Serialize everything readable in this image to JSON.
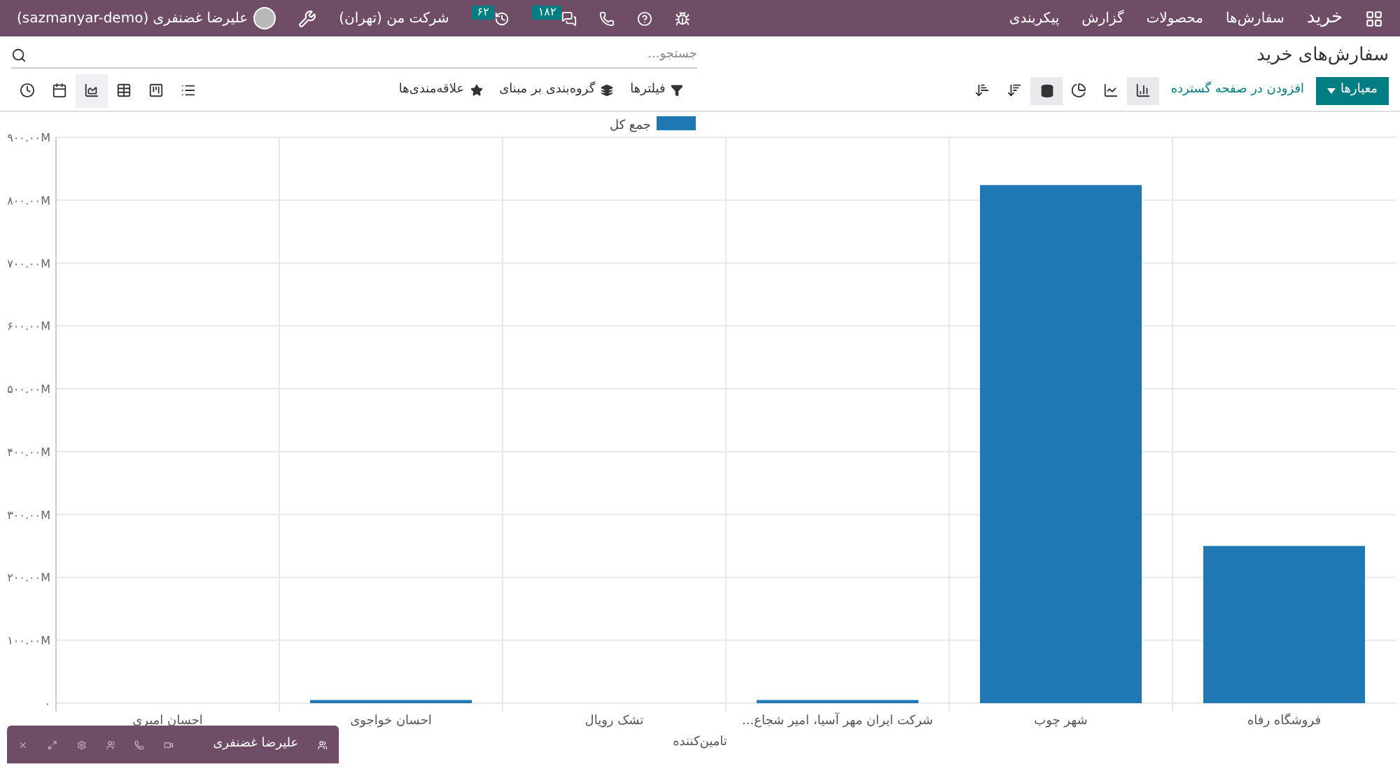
{
  "navbar": {
    "app_name": "خرید",
    "menus": [
      "سفارش‌ها",
      "محصولات",
      "گزارش",
      "پیکربندی"
    ],
    "systray": [
      {
        "kind": "bug"
      },
      {
        "kind": "help"
      },
      {
        "kind": "phone"
      },
      {
        "kind": "chat",
        "badge": "۱۸۲"
      },
      {
        "kind": "activity",
        "badge": "۶۲"
      }
    ],
    "company": "شرکت من (تهران)",
    "user": "علیرضا غضنفری (sazmanyar-demo)"
  },
  "page_title": "سفارش‌های خرید",
  "search": {
    "placeholder": "جستجو..."
  },
  "toolbar": {
    "measures_button": "معیارها",
    "insert_link": "افزودن در صفحه گسترده",
    "chart_types": [
      {
        "kind": "bar",
        "selected": true
      },
      {
        "kind": "line",
        "selected": false
      },
      {
        "kind": "pie",
        "selected": false
      }
    ],
    "stacked": {
      "on": true
    },
    "sorts": [
      {
        "kind": "descending"
      },
      {
        "kind": "ascending"
      }
    ],
    "filters": [
      {
        "kind": "filter",
        "label": "فیلترها"
      },
      {
        "kind": "group",
        "label": "گروه‌بندی بر مبنای"
      },
      {
        "kind": "favorite",
        "label": "علاقه‌مندی‌ها"
      }
    ],
    "views": [
      {
        "kind": "list",
        "selected": false
      },
      {
        "kind": "kanban",
        "selected": false
      },
      {
        "kind": "pivot",
        "selected": false
      },
      {
        "kind": "graph",
        "selected": true
      },
      {
        "kind": "calendar",
        "selected": false
      },
      {
        "kind": "activity",
        "selected": false
      }
    ]
  },
  "chart_data": {
    "type": "bar",
    "grid": true,
    "xlabel": "تامین‌کننده",
    "categories": [
      "احسان امیری",
      "احسان خواجوی",
      "تشک رویال",
      "شرکت ایران مهر آسیا، امیر شجاع...",
      "شهر چوب",
      "فروشگاه رفاه"
    ],
    "series": [
      {
        "name": "جمع کل",
        "color": "#1f77b4",
        "values": [
          0,
          5000000,
          0,
          5000000,
          824000000,
          250000000
        ]
      }
    ],
    "ylim": [
      0,
      900000000
    ],
    "yticks": [
      {
        "value": 0,
        "label": "۰"
      },
      {
        "value": 100000000,
        "label": "۱۰۰.۰۰M"
      },
      {
        "value": 200000000,
        "label": "۲۰۰.۰۰M"
      },
      {
        "value": 300000000,
        "label": "۳۰۰.۰۰M"
      },
      {
        "value": 400000000,
        "label": "۴۰۰.۰۰M"
      },
      {
        "value": 500000000,
        "label": "۵۰۰.۰۰M"
      },
      {
        "value": 600000000,
        "label": "۶۰۰.۰۰M"
      },
      {
        "value": 700000000,
        "label": "۷۰۰.۰۰M"
      },
      {
        "value": 800000000,
        "label": "۸۰۰.۰۰M"
      },
      {
        "value": 900000000,
        "label": "۹۰۰.۰۰M"
      }
    ]
  },
  "chat_window": {
    "name": "علیرضا غضنفری"
  }
}
